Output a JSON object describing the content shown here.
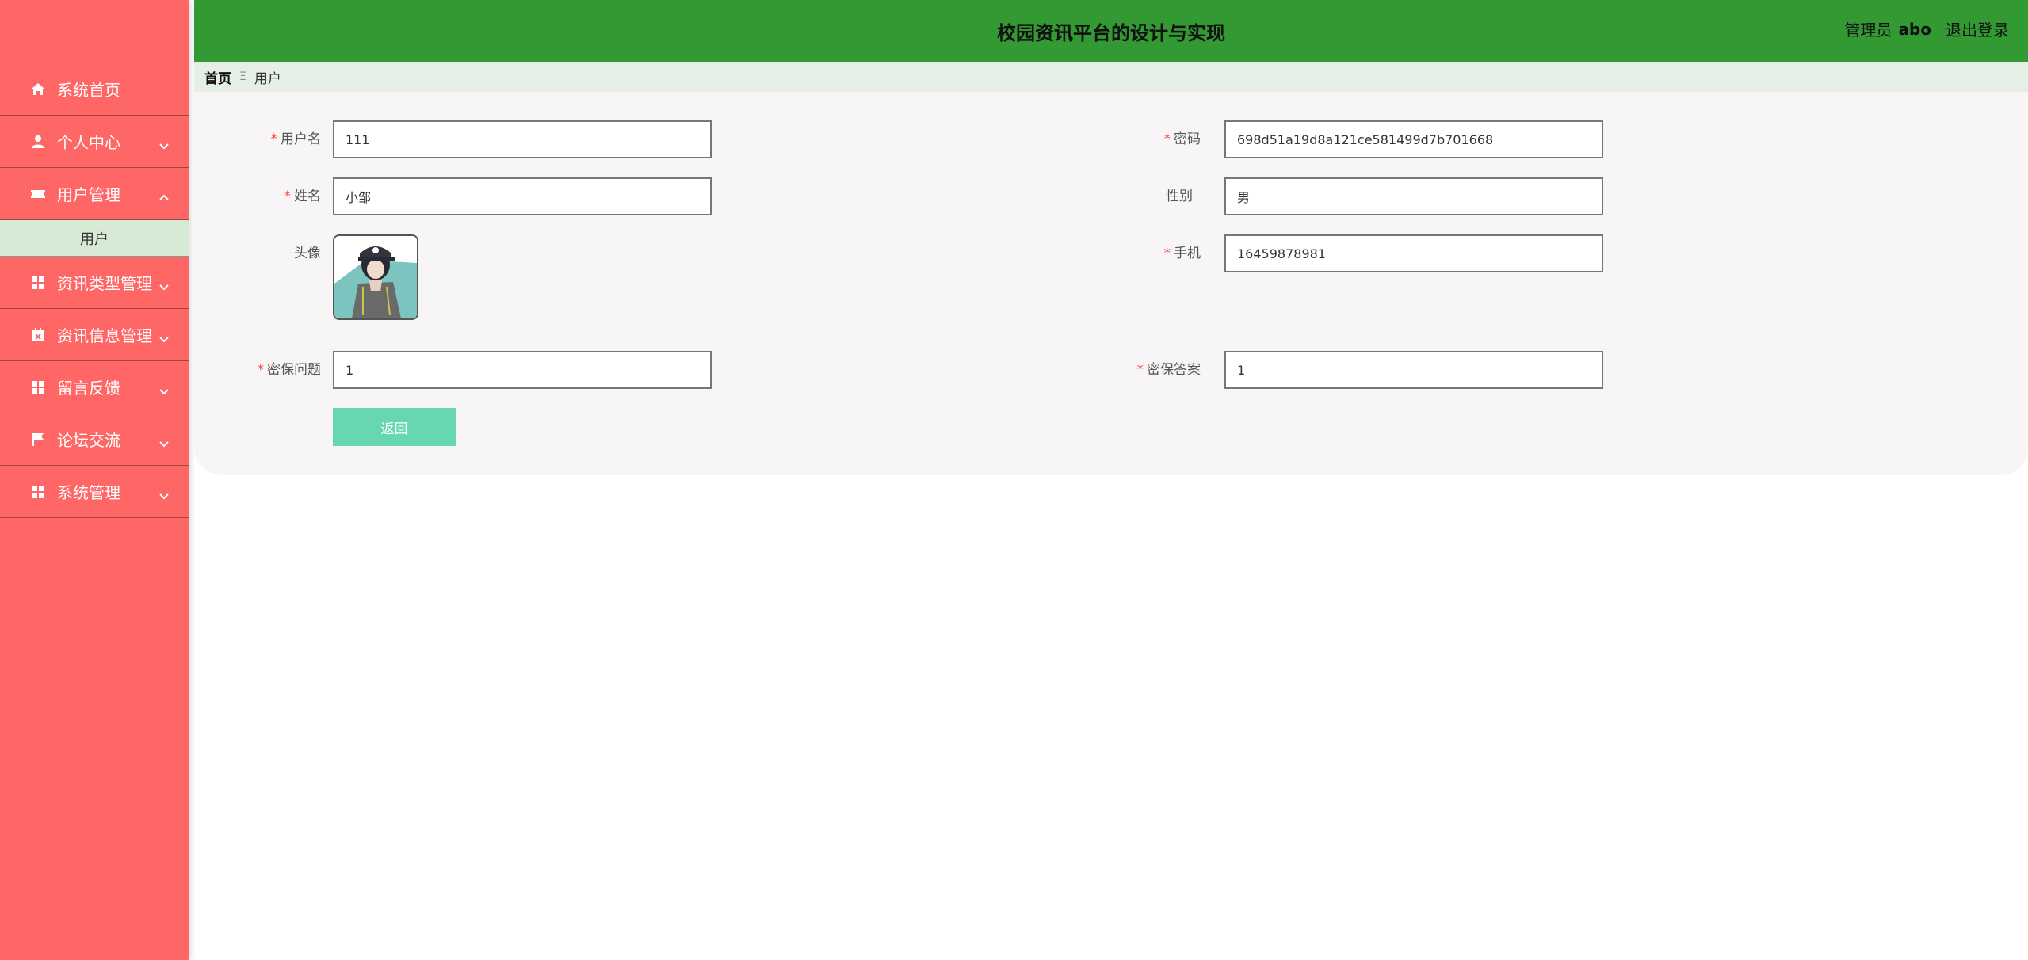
{
  "app": {
    "title": "校园资讯平台的设计与实现",
    "role": "管理员",
    "username": "abo",
    "logout_label": "退出登录"
  },
  "sidebar": {
    "items": [
      {
        "label": "系统首页",
        "icon": "home-icon"
      },
      {
        "label": "个人中心",
        "icon": "person-icon"
      },
      {
        "label": "用户管理",
        "icon": "ticket-icon"
      },
      {
        "label": "资讯类型管理",
        "icon": "grid-icon"
      },
      {
        "label": "资讯信息管理",
        "icon": "calendar-icon"
      },
      {
        "label": "留言反馈",
        "icon": "grid-icon"
      },
      {
        "label": "论坛交流",
        "icon": "flag-icon"
      },
      {
        "label": "系统管理",
        "icon": "grid-icon"
      }
    ],
    "submenu": {
      "label": "用户"
    }
  },
  "breadcrumb": {
    "home": "首页",
    "separator": "Ξ",
    "current": "用户"
  },
  "form": {
    "username": {
      "label": "用户名",
      "value": "111",
      "required": true
    },
    "password": {
      "label": "密码",
      "value": "698d51a19d8a121ce581499d7b701668",
      "required": true
    },
    "name": {
      "label": "姓名",
      "value": "小邹",
      "required": true
    },
    "gender": {
      "label": "性别",
      "value": "男",
      "required": false
    },
    "avatar": {
      "label": "头像"
    },
    "phone": {
      "label": "手机",
      "value": "16459878981",
      "required": true
    },
    "security_question": {
      "label": "密保问题",
      "value": "1",
      "required": true
    },
    "security_answer": {
      "label": "密保答案",
      "value": "1",
      "required": true
    },
    "back_label": "返回"
  },
  "colors": {
    "sidebar_bg": "#ff6666",
    "header_bg": "#339933",
    "submenu_bg": "#d7ead6",
    "button_bg": "#66d6b3",
    "required_mark": "#ff4444"
  }
}
